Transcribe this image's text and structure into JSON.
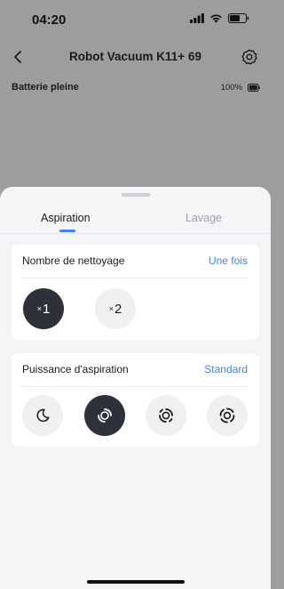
{
  "status_bar": {
    "time": "04:20",
    "icons": [
      "signal-icon",
      "wifi-icon",
      "battery-icon"
    ]
  },
  "nav": {
    "title": "Robot Vacuum K11+ 69",
    "icons": [
      "back-icon",
      "gear-icon"
    ]
  },
  "battery": {
    "label": "Batterie pleine",
    "percent": "100%",
    "level": 1.0
  },
  "tabs": [
    {
      "label": "Aspiration",
      "active": true
    },
    {
      "label": "Lavage",
      "active": false
    }
  ],
  "cleaning_count": {
    "title": "Nombre de nettoyage",
    "value": "Une fois",
    "options": [
      {
        "prefix": "×",
        "label": "1",
        "selected": true
      },
      {
        "prefix": "×",
        "label": "2",
        "selected": false
      }
    ]
  },
  "suction_power": {
    "title": "Puissance d'aspiration",
    "value": "Standard",
    "options": [
      {
        "icon": "moon-icon",
        "selected": false
      },
      {
        "icon": "swirl-standard-icon",
        "selected": true
      },
      {
        "icon": "swirl-strong-icon",
        "selected": false
      },
      {
        "icon": "swirl-max-icon",
        "selected": false
      }
    ]
  },
  "colors": {
    "accent": "#3f83ea",
    "selected_button": "#2e3139",
    "overlay": "#9d9d9d",
    "sheet": "#f5f5f7"
  }
}
